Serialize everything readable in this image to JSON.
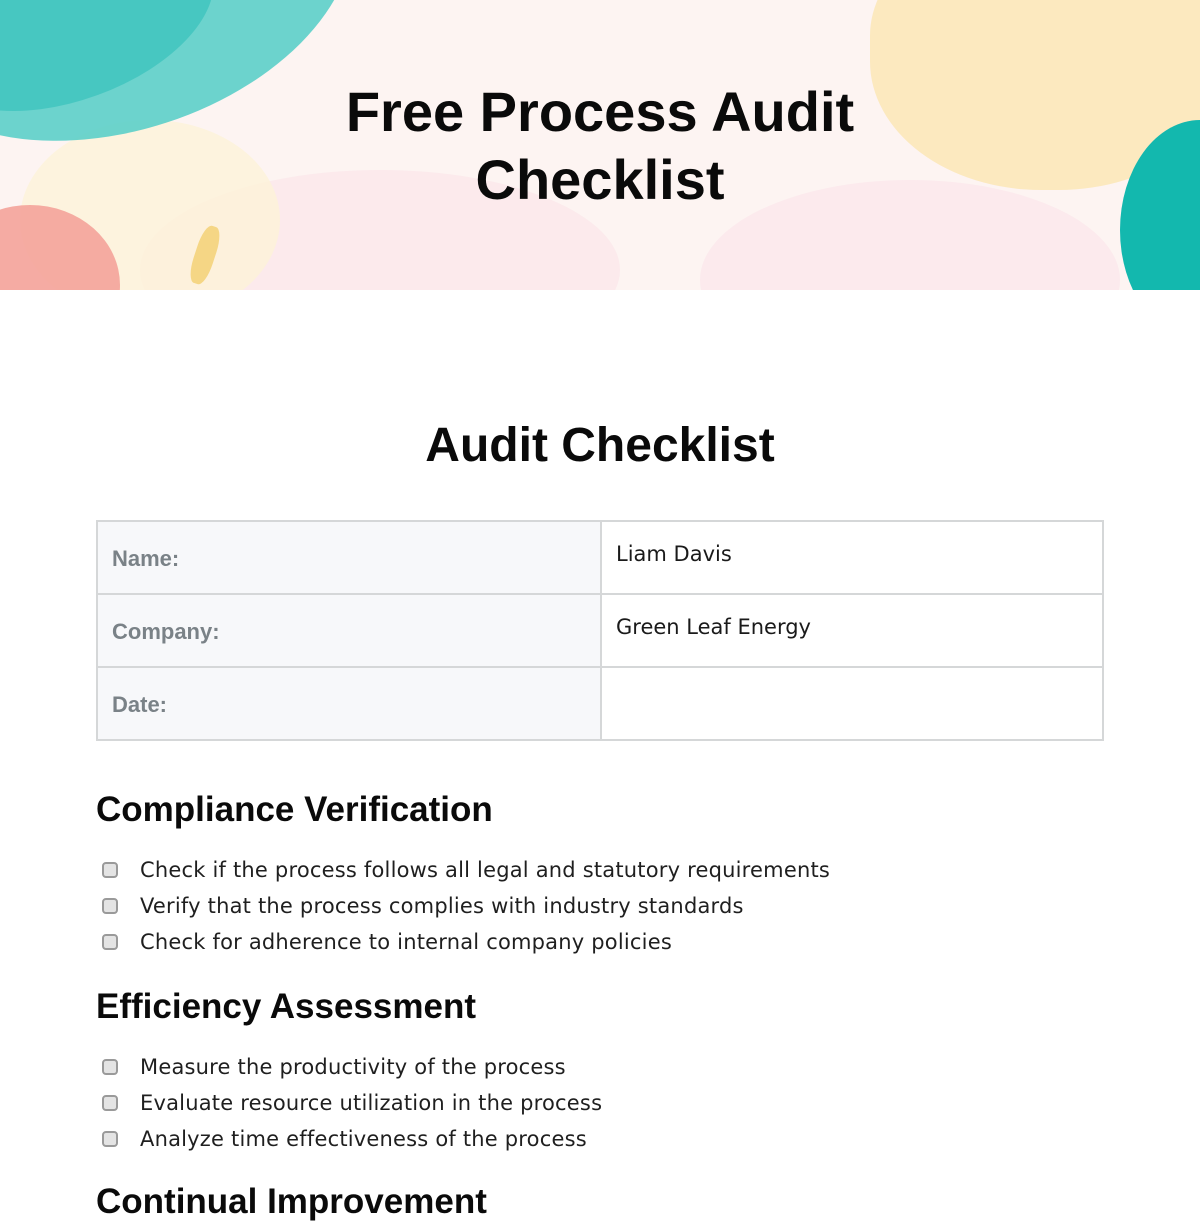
{
  "banner": {
    "title_line1": "Free Process Audit",
    "title_line2": "Checklist"
  },
  "document": {
    "title": "Audit Checklist"
  },
  "info_table": {
    "rows": [
      {
        "label": "Name:",
        "value": "Liam Davis"
      },
      {
        "label": "Company:",
        "value": "Green Leaf Energy"
      },
      {
        "label": "Date:",
        "value": ""
      }
    ]
  },
  "sections": [
    {
      "heading": "Compliance Verification",
      "items": [
        {
          "text": "Check if the process follows all legal and statutory requirements",
          "checked": false
        },
        {
          "text": "Verify that the process complies with industry standards",
          "checked": false
        },
        {
          "text": "Check for adherence to internal company policies",
          "checked": false
        }
      ]
    },
    {
      "heading": "Efficiency Assessment",
      "items": [
        {
          "text": "Measure the productivity of the process",
          "checked": false
        },
        {
          "text": "Evaluate resource utilization in the process",
          "checked": false
        },
        {
          "text": "Analyze time effectiveness of the process",
          "checked": false
        }
      ]
    },
    {
      "heading": "Continual Improvement",
      "items": []
    }
  ]
}
